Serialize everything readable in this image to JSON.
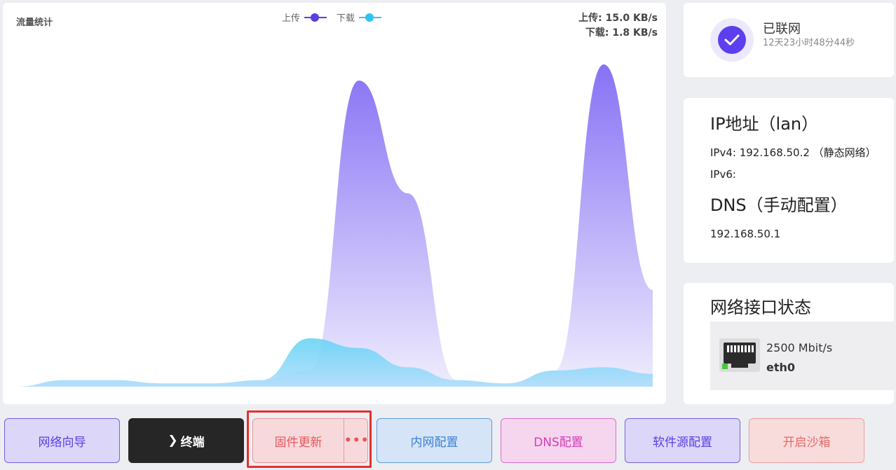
{
  "traffic": {
    "title": "流量统计",
    "legend": {
      "upload": "上传",
      "download": "下载"
    },
    "upload_rate": "上传: 15.0 KB/s",
    "download_rate": "下载: 1.8 KB/s"
  },
  "colors": {
    "upload": "#5a3fe3",
    "download": "#2fc3f0",
    "accent": "#5d3ff0"
  },
  "chart_data": {
    "type": "area",
    "series": [
      {
        "name": "上传",
        "values": [
          0,
          0.02,
          0.02,
          0.01,
          0.01,
          0.02,
          0.05,
          0.95,
          0.6,
          0.02,
          0.01,
          0.05,
          1.0,
          0.3
        ]
      },
      {
        "name": "下载",
        "values": [
          0,
          0.02,
          0.02,
          0.01,
          0.01,
          0.02,
          0.15,
          0.12,
          0.06,
          0.02,
          0.01,
          0.05,
          0.06,
          0.04
        ]
      }
    ]
  },
  "status": {
    "title": "已联网",
    "uptime": "12天23小时48分44秒",
    "icon": "check-icon"
  },
  "ip": {
    "title": "IP地址（lan）",
    "ipv4": "IPv4: 192.168.50.2 （静态网络）",
    "ipv6": "IPv6:",
    "dns_title": "DNS（手动配置）",
    "dns_value": "192.168.50.1"
  },
  "interfaces": {
    "title": "网络接口状态",
    "items": [
      {
        "speed": "2500 Mbit/s",
        "name": "eth0",
        "icon": "ethernet-port-icon"
      }
    ]
  },
  "buttons": {
    "wizard": "网络向导",
    "terminal": "终端",
    "terminal_prefix": "❯",
    "firmware": "固件更新",
    "firmware_more": "•••",
    "lan": "内网配置",
    "dns": "DNS配置",
    "source": "软件源配置",
    "sandbox": "开启沙箱"
  }
}
